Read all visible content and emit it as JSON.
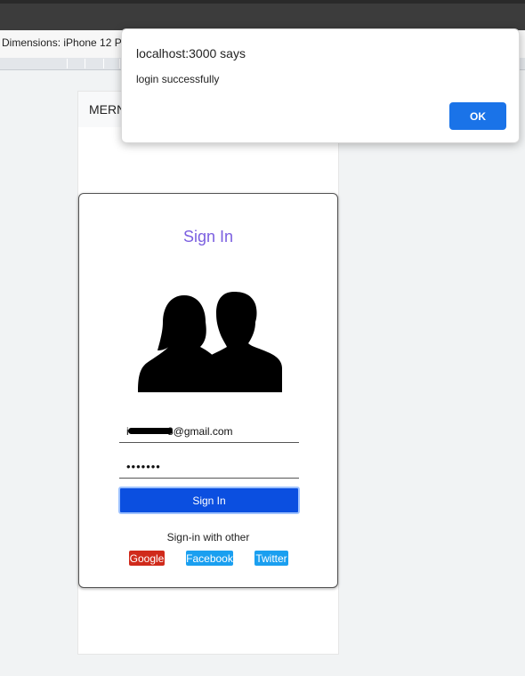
{
  "devtools": {
    "dimensions_label": "Dimensions: iPhone 12 P"
  },
  "phone": {
    "header_title": "MERN"
  },
  "signin_card": {
    "title": "Sign In",
    "avatar_icon": "couple-silhouette-icon",
    "email_value": "i             8@gmail.com",
    "password_value": "•••••••",
    "signin_button": "Sign In",
    "other_label": "Sign-in with other",
    "social": {
      "google": "Google",
      "facebook": "Facebook",
      "twitter": "Twitter"
    },
    "colors": {
      "title": "#7b5fe0",
      "primary_button": "#0b4fe0",
      "google": "#d02a1b",
      "facebook": "#1a9ff0",
      "twitter": "#1a9ff0"
    }
  },
  "dialog": {
    "title": "localhost:3000 says",
    "message": "login successfully",
    "ok_label": "OK",
    "ok_color": "#1a73e8"
  }
}
